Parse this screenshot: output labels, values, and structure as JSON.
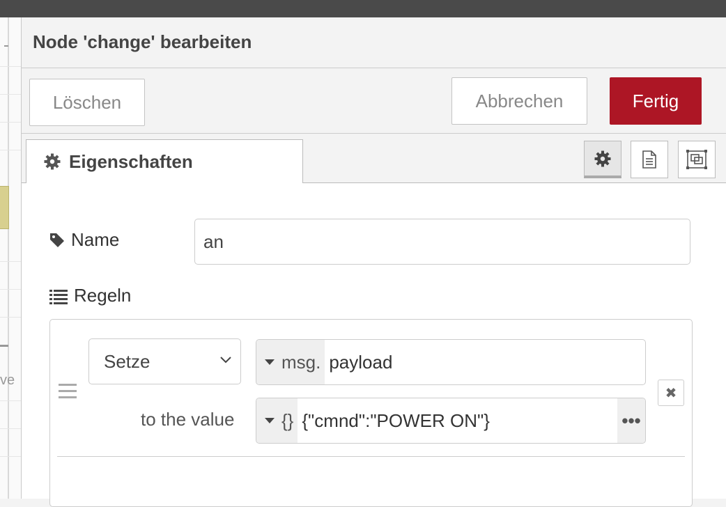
{
  "dialog": {
    "title": "Node 'change' bearbeiten"
  },
  "toolbar": {
    "delete_label": "Löschen",
    "cancel_label": "Abbrechen",
    "done_label": "Fertig",
    "done_color": "#ad1625"
  },
  "tabs": {
    "properties_label": "Eigenschaften",
    "icons": [
      "gear-icon",
      "document-icon",
      "appearance-icon"
    ]
  },
  "form": {
    "name_label": "Name",
    "name_value": "an",
    "rules_label": "Regeln"
  },
  "rule": {
    "action": "Setze",
    "property_type": "msg.",
    "property_value": "payload",
    "to_value_label": "to the value",
    "value_type": "{}",
    "value": "{\"cmnd\":\"POWER ON\"}",
    "expand_glyph": "•••",
    "remove_glyph": "✖"
  },
  "left_fragment": "ve"
}
